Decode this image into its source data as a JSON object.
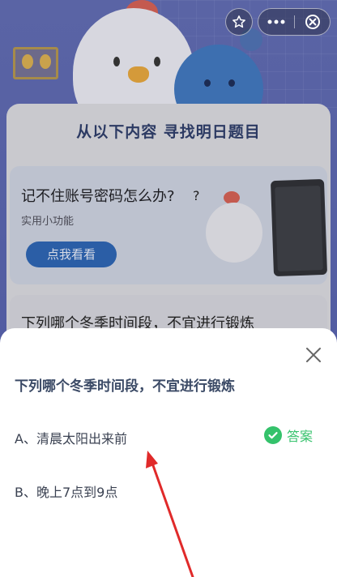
{
  "header": {
    "star_icon": "star-outline-icon",
    "more_icon": "more-dots-icon",
    "close_icon": "close-circle-icon"
  },
  "background": {
    "title": "从以下内容  寻找明日题目",
    "tip_card": {
      "title": "记不住账号密码怎么办?",
      "subtitle": "实用小功能",
      "button_label": "点我看看",
      "question_mark": "?"
    },
    "question_preview": "下列哪个冬季时间段，不宜进行锻炼"
  },
  "sheet": {
    "question": "下列哪个冬季时间段，不宜进行锻炼",
    "options": [
      {
        "label": "A、清晨太阳出来前",
        "is_answer": true
      },
      {
        "label": "B、晚上7点到9点",
        "is_answer": false
      }
    ],
    "answer_label": "答案",
    "close_icon": "close-x-icon"
  },
  "colors": {
    "answer_green": "#34c26b",
    "question_text": "#3b4a66",
    "arrow_red": "#e02a2a"
  }
}
